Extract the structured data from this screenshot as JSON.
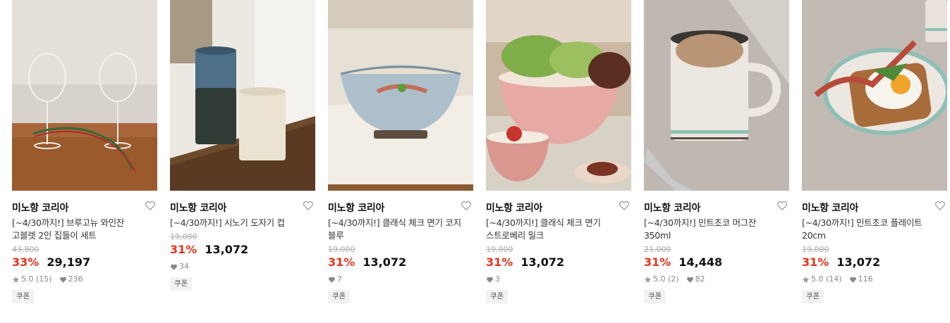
{
  "products": [
    {
      "brand": "미노항 코리아",
      "title_line1": "[~4/30까지!] 브루고뉴 와인잔",
      "title_line2": "고블렛 2인 집들이 세트",
      "original_price": "43,800",
      "discount": "33%",
      "price": "29,197",
      "rating": "5.0 (15)",
      "likes": "236",
      "coupon": "쿠폰"
    },
    {
      "brand": "미노항 코리아",
      "title_line1": "[~4/30까지!] 시노기 도자기 컵",
      "title_line2": "",
      "original_price": "19,000",
      "discount": "31%",
      "price": "13,072",
      "rating": "",
      "likes": "34",
      "coupon": "쿠폰"
    },
    {
      "brand": "미노항 코리아",
      "title_line1": "[~4/30까지!] 클래식 체크 면기 코지",
      "title_line2": "블루",
      "original_price": "19,000",
      "discount": "31%",
      "price": "13,072",
      "rating": "",
      "likes": "7",
      "coupon": "쿠폰"
    },
    {
      "brand": "미노항 코리아",
      "title_line1": "[~4/30까지!] 클래식 체크 면기",
      "title_line2": "스트로베리 밀크",
      "original_price": "19,000",
      "discount": "31%",
      "price": "13,072",
      "rating": "",
      "likes": "3",
      "coupon": "쿠폰"
    },
    {
      "brand": "미노항 코리아",
      "title_line1": "[~4/30까지!] 민트초코 머그잔",
      "title_line2": "350ml",
      "original_price": "21,000",
      "discount": "31%",
      "price": "14,448",
      "rating": "5.0 (2)",
      "likes": "82",
      "coupon": "쿠폰"
    },
    {
      "brand": "미노항 코리아",
      "title_line1": "[~4/30까지!] 민트초코 플레이트",
      "title_line2": "20cm",
      "original_price": "19,000",
      "discount": "31%",
      "price": "13,072",
      "rating": "5.0 (14)",
      "likes": "116",
      "coupon": "쿠폰"
    }
  ],
  "icons": {
    "wishlist": "heart-outline-icon",
    "rating": "star-icon",
    "likes": "heart-filled-icon"
  },
  "colors": {
    "discount": "#e8331c",
    "meta": "#888888",
    "coupon_bg": "#f2f2f2"
  }
}
